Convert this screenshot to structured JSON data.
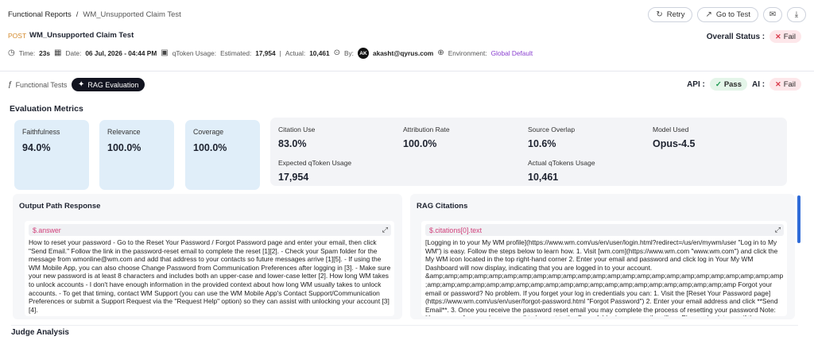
{
  "breadcrumb": {
    "root": "Functional Reports",
    "sep": "/",
    "leaf": "WM_Unsupported Claim Test"
  },
  "actions": {
    "retry": "Retry",
    "go_to_test": "Go to Test"
  },
  "test": {
    "method": "POST",
    "name": "WM_Unsupported Claim Test"
  },
  "overall": {
    "label": "Overall Status :",
    "value": "Fail"
  },
  "meta": {
    "time_label": "Time:",
    "time": "23s",
    "date_label": "Date:",
    "date": "06 Jul, 2026 - 04:44 PM",
    "qtoken_label": "qToken Usage:",
    "estimated_label": "Estimated:",
    "estimated": "17,954",
    "actual_label": "Actual:",
    "actual": "10,461",
    "by_label": "By:",
    "avatar": "AK",
    "user": "akasht@qyrus.com",
    "env_label": "Environment:",
    "env": "Global Default"
  },
  "tabs": {
    "functional": "Functional Tests",
    "rag": "RAG Evaluation"
  },
  "status": {
    "api_label": "API :",
    "api_value": "Pass",
    "ai_label": "AI :",
    "ai_value": "Fail"
  },
  "evaluation": {
    "title": "Evaluation Metrics",
    "cards": [
      {
        "label": "Faithfulness",
        "value": "94.0%"
      },
      {
        "label": "Relevance",
        "value": "100.0%"
      },
      {
        "label": "Coverage",
        "value": "100.0%"
      }
    ],
    "stats": [
      {
        "label": "Citation Use",
        "value": "83.0%"
      },
      {
        "label": "Attribution Rate",
        "value": "100.0%"
      },
      {
        "label": "Source Overlap",
        "value": "10.6%"
      },
      {
        "label": "Model Used",
        "value": "Opus-4.5"
      },
      {
        "label": "Expected qToken Usage",
        "value": "17,954"
      },
      {
        "label": "Actual qTokens Usage",
        "value": "10,461"
      }
    ]
  },
  "output": {
    "title": "Output Path Response",
    "path": "$.answer",
    "text": "How to reset your password - Go to the Reset Your Password / Forgot Password page and enter your email, then click \"Send Email.\" Follow the link in the password-reset email to complete the reset [1][2]. - Check your Spam folder for the message from wmonline@wm.com and add that address to your contacts so future messages arrive [1][5]. - If using the WM Mobile App, you can also choose Change Password from Communication Preferences after logging in [3]. - Make sure your new password is at least 8 characters and includes both an upper-case and lower-case letter [2]. How long WM takes to unlock accounts - I don't have enough information in the provided context about how long WM usually takes to unlock accounts. - To get that timing, contact WM Support (you can use the WM Mobile App's Contact Support/Communication Preferences or submit a Support Request via the \"Request Help\" option) so they can assist with unlocking your account [3][4]."
  },
  "citations": {
    "title": "RAG Citations",
    "path": "$.citations[0].text",
    "text": "[Logging in to your My WM profile](https://www.wm.com/us/en/user/login.html?redirect=/us/en/mywm/user \"Log in to My WM\") is easy. Follow the steps below to learn how. 1. Visit [wm.com](https://www.wm.com \"www.wm.com\") and click the My WM icon located in the top right-hand corner 2. Enter your email and password and click log in Your My WM Dashboard will now display, indicating that you are logged in to your account. &amp;amp;amp;amp;amp;amp;amp;amp;amp;amp;amp;amp;amp;amp;amp;amp;amp;amp;amp;amp;amp;amp;amp;amp;amp;amp;amp;amp;amp;amp;amp;amp;amp;amp;amp;amp;amp;amp;amp;amp;amp;amp;amp;amp;amp Forgot your email or password? No problem. If you forget your log in credentials you can: 1. Visit the [Reset Your Password page](https://www.wm.com/us/en/user/forgot-password.html \"Forgot Password\") 2. Enter your email address and click **Send Email**. 3. Once you receive the password reset email you may complete the process of resetting your password Note: It's common for an unknown email to be sent to the Spam folder in your email mailbox. Please check to see if the password reset email from [wmonline@wm.com](mailto:wmonline@wm.com) is located in"
  },
  "judge": {
    "title": "Judge Analysis"
  }
}
